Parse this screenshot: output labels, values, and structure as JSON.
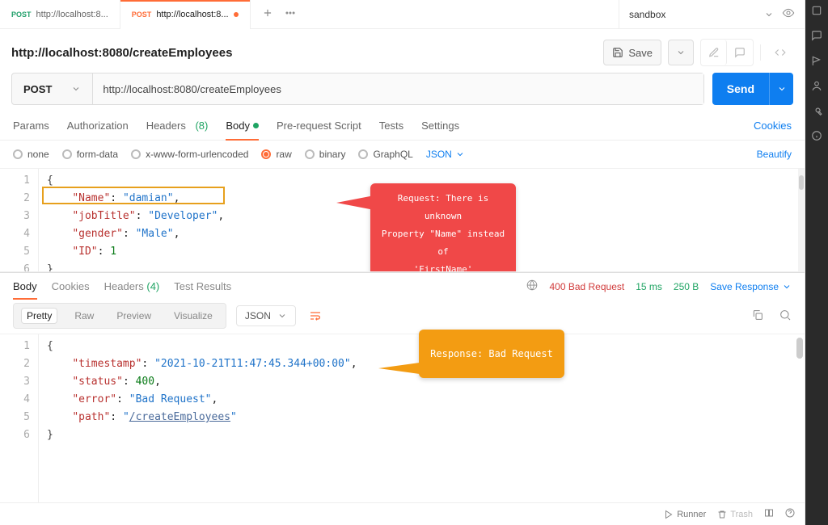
{
  "tabs": [
    {
      "method": "POST",
      "label": "http://localhost:8..."
    },
    {
      "method": "POST",
      "label": "http://localhost:8...",
      "active": true,
      "dirty": true
    }
  ],
  "environment": {
    "name": "sandbox"
  },
  "request": {
    "title": "http://localhost:8080/createEmployees",
    "save_label": "Save",
    "method": "POST",
    "url": "http://localhost:8080/createEmployees",
    "send_label": "Send"
  },
  "subtabs": {
    "params": "Params",
    "authorization": "Authorization",
    "headers": "Headers",
    "headers_count": "(8)",
    "body": "Body",
    "prerequest": "Pre-request Script",
    "tests": "Tests",
    "settings": "Settings",
    "cookies": "Cookies"
  },
  "body_options": {
    "none": "none",
    "formdata": "form-data",
    "urlencoded": "x-www-form-urlencoded",
    "raw": "raw",
    "binary": "binary",
    "graphql": "GraphQL",
    "lang": "JSON",
    "beautify": "Beautify"
  },
  "request_body": {
    "l1": "{",
    "k1": "\"Name\"",
    "v1": "\"damian\"",
    "k2": "\"jobTitle\"",
    "v2": "\"Developer\"",
    "k3": "\"gender\"",
    "v3": "\"Male\"",
    "k4": "\"ID\"",
    "v4": "1",
    "l6": "}"
  },
  "callouts": {
    "request": "Request: There is unknown\nProperty \"Name\" instead of\n'FirstName'",
    "response": "Response: Bad Request"
  },
  "response": {
    "tabs": {
      "body": "Body",
      "cookies": "Cookies",
      "headers": "Headers",
      "headers_count": "(4)",
      "test_results": "Test Results"
    },
    "status": "400 Bad Request",
    "time": "15 ms",
    "size": "250 B",
    "save": "Save Response",
    "views": {
      "pretty": "Pretty",
      "raw": "Raw",
      "preview": "Preview",
      "visualize": "Visualize"
    },
    "lang": "JSON"
  },
  "response_body": {
    "l1": "{",
    "k1": "\"timestamp\"",
    "v1": "\"2021-10-21T11:47:45.344+00:00\"",
    "k2": "\"status\"",
    "v2": "400",
    "k3": "\"error\"",
    "v3": "\"Bad Request\"",
    "k4": "\"path\"",
    "v4": "\"",
    "v4p": "/createEmployees",
    "v4e": "\"",
    "l6": "}"
  },
  "footer": {
    "runner": "Runner",
    "trash": "Trash"
  }
}
